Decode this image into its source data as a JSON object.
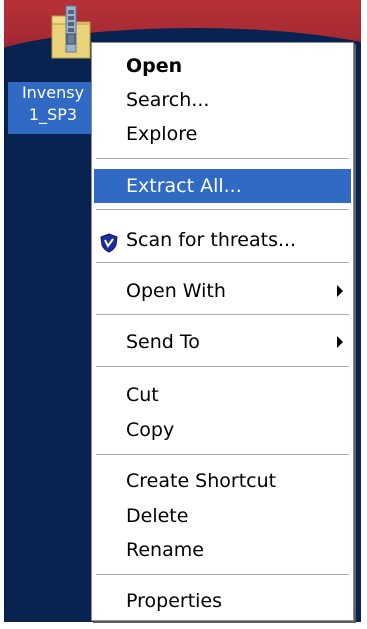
{
  "desktop": {
    "icon": {
      "name": "zip-folder-icon",
      "label_line1": "Invensy",
      "label_line2": "1_SP3"
    }
  },
  "context_menu": {
    "items": [
      {
        "label": "Open"
      },
      {
        "label": "Search..."
      },
      {
        "label": "Explore"
      },
      {
        "label": "Extract All..."
      },
      {
        "label": "Scan for threats...",
        "icon": "shield-icon"
      },
      {
        "label": "Open With"
      },
      {
        "label": "Send To"
      },
      {
        "label": "Cut"
      },
      {
        "label": "Copy"
      },
      {
        "label": "Create Shortcut"
      },
      {
        "label": "Delete"
      },
      {
        "label": "Rename"
      },
      {
        "label": "Properties"
      }
    ],
    "submenu_arrow_icon": "chevron-right-icon"
  },
  "colors": {
    "desktop_bg": "#08234f",
    "selection": "#316ac5",
    "wallpaper_red": "#b53237"
  }
}
